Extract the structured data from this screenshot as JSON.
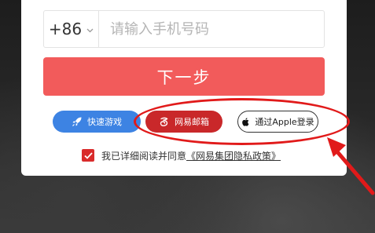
{
  "phone": {
    "country_code": "+86",
    "placeholder": "请输入手机号码",
    "value": ""
  },
  "next_button": {
    "label": "下一步"
  },
  "login_options": {
    "quick_game": {
      "label": "快速游戏",
      "icon": "rocket-icon",
      "color": "#3d83e3"
    },
    "netease_mail": {
      "label": "网易邮箱",
      "icon": "netease-logo-icon",
      "color": "#c9282a"
    },
    "apple_login": {
      "label": "通过Apple登录",
      "icon": "apple-icon",
      "color": "#ffffff"
    }
  },
  "agreement": {
    "checked": true,
    "text": "我已详细阅读并同意",
    "link_text": "《网易集团隐私政策》"
  },
  "annotation": {
    "ellipse_color": "#e11a1a",
    "arrow_color": "#e11a1a"
  }
}
